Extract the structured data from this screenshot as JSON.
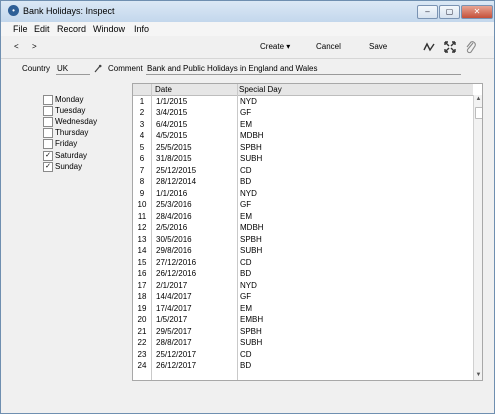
{
  "window": {
    "title": "Bank Holidays: Inspect",
    "app_icon": "•",
    "controls": [
      "‒",
      "▢",
      "✕"
    ]
  },
  "menubar": [
    "File",
    "Edit",
    "Record",
    "Window",
    "Info"
  ],
  "toolbar": {
    "nav_prev": "<",
    "nav_next": ">",
    "create_label": "Create ▾",
    "cancel_label": "Cancel",
    "save_label": "Save",
    "icons": [
      "wave-icon",
      "expand-icon",
      "paperclip-icon"
    ]
  },
  "form": {
    "country_label": "Country",
    "country_value": "UK",
    "comment_label": "Comment",
    "comment_value": "Bank and Public Holidays in England and Wales"
  },
  "days": [
    {
      "label": "Monday",
      "checked": false
    },
    {
      "label": "Tuesday",
      "checked": false
    },
    {
      "label": "Wednesday",
      "checked": false
    },
    {
      "label": "Thursday",
      "checked": false
    },
    {
      "label": "Friday",
      "checked": false
    },
    {
      "label": "Saturday",
      "checked": true
    },
    {
      "label": "Sunday",
      "checked": true
    }
  ],
  "grid": {
    "headers": [
      "Date",
      "Special Day"
    ],
    "rows": [
      [
        "1",
        "1/1/2015",
        "NYD"
      ],
      [
        "2",
        "3/4/2015",
        "GF"
      ],
      [
        "3",
        "6/4/2015",
        "EM"
      ],
      [
        "4",
        "4/5/2015",
        "MDBH"
      ],
      [
        "5",
        "25/5/2015",
        "SPBH"
      ],
      [
        "6",
        "31/8/2015",
        "SUBH"
      ],
      [
        "7",
        "25/12/2015",
        "CD"
      ],
      [
        "8",
        "28/12/2014",
        "BD"
      ],
      [
        "9",
        "1/1/2016",
        "NYD"
      ],
      [
        "10",
        "25/3/2016",
        "GF"
      ],
      [
        "11",
        "28/4/2016",
        "EM"
      ],
      [
        "12",
        "2/5/2016",
        "MDBH"
      ],
      [
        "13",
        "30/5/2016",
        "SPBH"
      ],
      [
        "14",
        "29/8/2016",
        "SUBH"
      ],
      [
        "15",
        "27/12/2016",
        "CD"
      ],
      [
        "16",
        "26/12/2016",
        "BD"
      ],
      [
        "17",
        "2/1/2017",
        "NYD"
      ],
      [
        "18",
        "14/4/2017",
        "GF"
      ],
      [
        "19",
        "17/4/2017",
        "EM"
      ],
      [
        "20",
        "1/5/2017",
        "EMBH"
      ],
      [
        "21",
        "29/5/2017",
        "SPBH"
      ],
      [
        "22",
        "28/8/2017",
        "SUBH"
      ],
      [
        "23",
        "25/12/2017",
        "CD"
      ],
      [
        "24",
        "26/12/2017",
        "BD"
      ]
    ]
  },
  "scroll": {
    "up": "▲",
    "down": "▼"
  }
}
